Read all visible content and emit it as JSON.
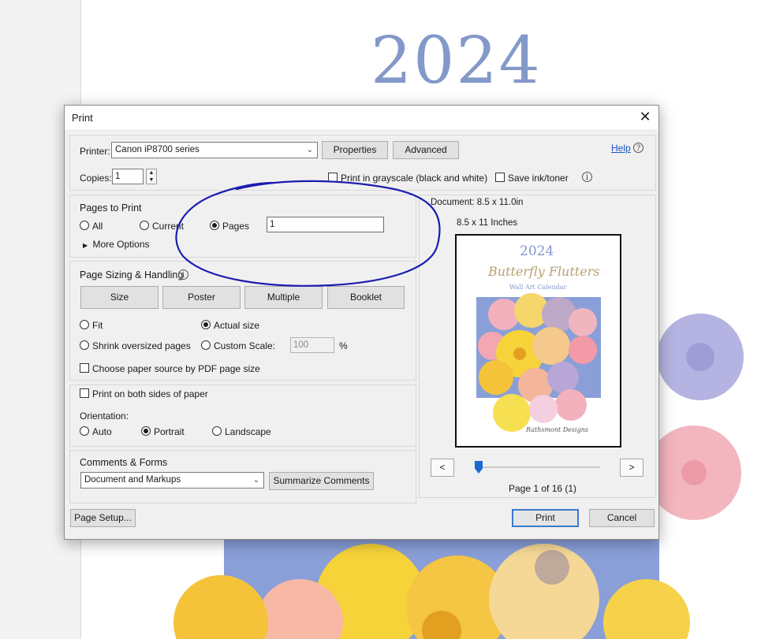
{
  "background": {
    "year": "2024"
  },
  "dialog": {
    "title": "Print",
    "close_glyph": "✕",
    "printer_label": "Printer:",
    "printer_value": "Canon iP8700 series",
    "properties_label": "Properties",
    "advanced_label": "Advanced",
    "help_label": "Help",
    "copies_label": "Copies:",
    "copies_value": "1",
    "grayscale_label": "Print in grayscale (black and white)",
    "save_ink_label": "Save ink/toner",
    "pages_to_print": {
      "title": "Pages to Print",
      "all_label": "All",
      "current_label": "Current",
      "pages_label": "Pages",
      "pages_value": "1",
      "selected": "pages",
      "more_options_label": "More Options"
    },
    "sizing": {
      "title": "Page Sizing & Handling",
      "size_label": "Size",
      "poster_label": "Poster",
      "multiple_label": "Multiple",
      "booklet_label": "Booklet",
      "fit_label": "Fit",
      "actual_size_label": "Actual size",
      "shrink_label": "Shrink oversized pages",
      "custom_scale_label": "Custom Scale:",
      "custom_scale_value": "100",
      "percent_label": "%",
      "paper_source_label": "Choose paper source by PDF page size",
      "selected": "actual"
    },
    "both_sides_label": "Print on both sides of paper",
    "orientation": {
      "label": "Orientation:",
      "auto_label": "Auto",
      "portrait_label": "Portrait",
      "landscape_label": "Landscape",
      "selected": "portrait"
    },
    "comments": {
      "title": "Comments & Forms",
      "value": "Document and Markups",
      "summarize_label": "Summarize Comments"
    },
    "preview": {
      "document_info": "Document: 8.5 x 11.0in",
      "paper_size": "8.5 x 11 Inches",
      "thumb_year": "2024",
      "thumb_title": "Butterfly Flutters",
      "thumb_subtitle": "Wall Art Calendar",
      "thumb_brand": "Rathsmont Designs",
      "prev_label": "<",
      "next_label": ">",
      "page_status": "Page 1 of 16 (1)",
      "page_position": 0.0
    },
    "page_setup_label": "Page Setup...",
    "print_label": "Print",
    "cancel_label": "Cancel"
  },
  "colors": {
    "year_blue": "#8399c9",
    "link_blue": "#1a55c4",
    "annotation_blue": "#1b1bb0",
    "accent": "#1c6ad0"
  }
}
